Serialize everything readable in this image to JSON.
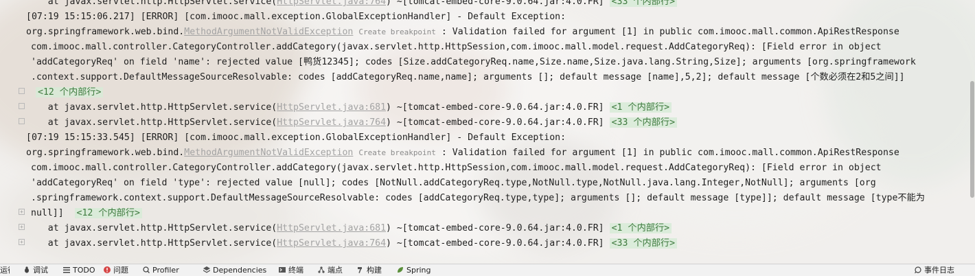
{
  "console": {
    "lines": [
      {
        "indent": 38,
        "parts": [
          {
            "t": "    at javax.servlet.http.HttpServlet.service("
          },
          {
            "t": "HttpServlet.java:764",
            "c": "link"
          },
          {
            "t": ") ~[tomcat-embed-core-9.0.64.jar:4.0.FR] "
          },
          {
            "t": "<33 个内部行>",
            "c": "fold-text"
          }
        ]
      },
      {
        "indent": 38,
        "parts": [
          {
            "t": "[07:19 15:15:06.217] [ERROR] [com.imooc.mall.exception.GlobalExceptionHandler] - Default Exception:"
          }
        ]
      },
      {
        "indent": 38,
        "parts": [
          {
            "t": "org.springframework.web.bind."
          },
          {
            "t": "MethodArgumentNotValidException",
            "c": "link"
          },
          {
            "t": " "
          },
          {
            "t": "Create breakpoint",
            "c": "bp"
          },
          {
            "t": " : Validation failed for argument [1] in public com.imooc.mall.common.ApiRestResponse"
          }
        ]
      },
      {
        "indent": 45,
        "parts": [
          {
            "t": "com.imooc.mall.controller.CategoryController.addCategory(javax.servlet.http.HttpSession,com.imooc.mall.model.request.AddCategoryReq): [Field error in object"
          }
        ]
      },
      {
        "indent": 45,
        "parts": [
          {
            "t": "'addCategoryReq' on field 'name': rejected value [鸭货12345]; codes [Size.addCategoryReq.name,Size.name,Size.java.lang.String,Size]; arguments [org.springframework"
          }
        ]
      },
      {
        "indent": 45,
        "parts": [
          {
            "t": ".context.support.DefaultMessageSourceResolvable: codes [addCategoryReq.name,name]; arguments []; default message [name],5,2]; default message [个数必须在2和5之间]]"
          }
        ]
      },
      {
        "indent": 52,
        "parts": [
          {
            "t": "<12 个内部行>",
            "c": "fold-text"
          }
        ]
      },
      {
        "indent": 38,
        "parts": [
          {
            "t": "    at javax.servlet.http.HttpServlet.service("
          },
          {
            "t": "HttpServlet.java:681",
            "c": "link"
          },
          {
            "t": ") ~[tomcat-embed-core-9.0.64.jar:4.0.FR] "
          },
          {
            "t": "<1 个内部行>",
            "c": "fold-text"
          }
        ]
      },
      {
        "indent": 38,
        "parts": [
          {
            "t": "    at javax.servlet.http.HttpServlet.service("
          },
          {
            "t": "HttpServlet.java:764",
            "c": "link"
          },
          {
            "t": ") ~[tomcat-embed-core-9.0.64.jar:4.0.FR] "
          },
          {
            "t": "<33 个内部行>",
            "c": "fold-text"
          }
        ]
      },
      {
        "indent": 38,
        "parts": [
          {
            "t": "[07:19 15:15:33.545] [ERROR] [com.imooc.mall.exception.GlobalExceptionHandler] - Default Exception:"
          }
        ]
      },
      {
        "indent": 38,
        "parts": [
          {
            "t": "org.springframework.web.bind."
          },
          {
            "t": "MethodArgumentNotValidException",
            "c": "link"
          },
          {
            "t": " "
          },
          {
            "t": "Create breakpoint",
            "c": "bp"
          },
          {
            "t": " : Validation failed for argument [1] in public com.imooc.mall.common.ApiRestResponse"
          }
        ]
      },
      {
        "indent": 45,
        "parts": [
          {
            "t": "com.imooc.mall.controller.CategoryController.addCategory(javax.servlet.http.HttpSession,com.imooc.mall.model.request.AddCategoryReq): [Field error in object"
          }
        ]
      },
      {
        "indent": 45,
        "parts": [
          {
            "t": "'addCategoryReq' on field 'type': rejected value [null]; codes [NotNull.addCategoryReq.type,NotNull.type,NotNull.java.lang.Integer,NotNull]; arguments [org"
          }
        ]
      },
      {
        "indent": 45,
        "parts": [
          {
            "t": ".springframework.context.support.DefaultMessageSourceResolvable: codes [addCategoryReq.type,type]; arguments []; default message [type]]; default message [type不能为"
          }
        ]
      },
      {
        "indent": 45,
        "parts": [
          {
            "t": "null]]  "
          },
          {
            "t": "<12 个内部行>",
            "c": "fold-text"
          }
        ]
      },
      {
        "indent": 38,
        "parts": [
          {
            "t": "    at javax.servlet.http.HttpServlet.service("
          },
          {
            "t": "HttpServlet.java:681",
            "c": "link"
          },
          {
            "t": ") ~[tomcat-embed-core-9.0.64.jar:4.0.FR] "
          },
          {
            "t": "<1 个内部行>",
            "c": "fold-text"
          }
        ]
      },
      {
        "indent": 38,
        "parts": [
          {
            "t": "    at javax.servlet.http.HttpServlet.service("
          },
          {
            "t": "HttpServlet.java:764",
            "c": "link"
          },
          {
            "t": ") ~[tomcat-embed-core-9.0.64.jar:4.0.FR] "
          },
          {
            "t": "<33 个内部行>",
            "c": "fold-text"
          }
        ]
      }
    ]
  },
  "statusbar": {
    "run": "运行",
    "debug": "调试",
    "todo": "TODO",
    "problems": "问题",
    "profiler": "Profiler",
    "dependencies": "Dependencies",
    "terminal": "终端",
    "endpoints": "端点",
    "build": "构建",
    "spring": "Spring",
    "event_log": "事件日志"
  },
  "colors": {
    "link": "#a3a3a3",
    "fold_bg": "#d7ebd7",
    "fold_text": "#3e7a3e",
    "problems_icon": "#d64545"
  }
}
